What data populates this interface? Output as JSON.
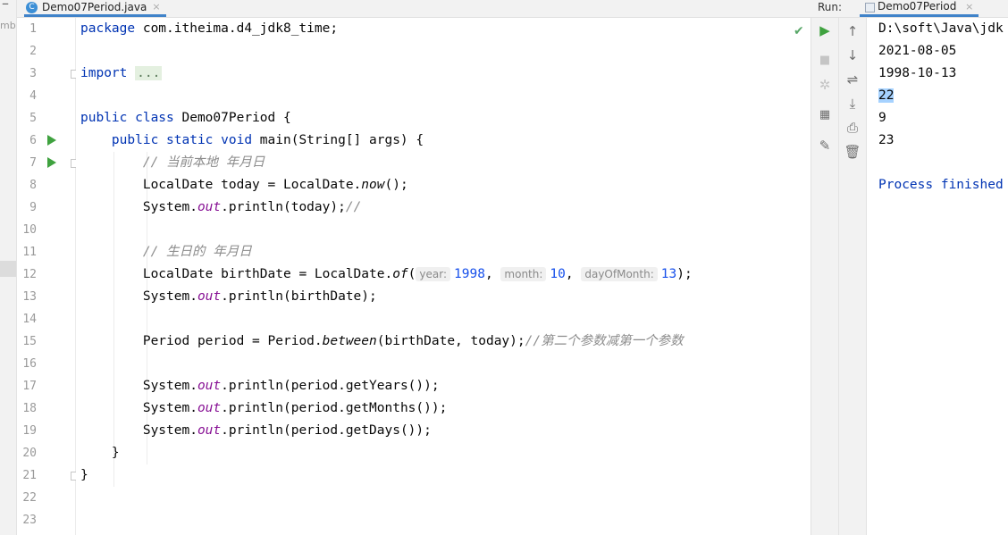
{
  "left_strip": {
    "text": "mb"
  },
  "editor": {
    "tab_title": "Demo07Period.java",
    "tab_close": "×",
    "class_icon_letter": "C",
    "line_numbers": [
      "1",
      "2",
      "3",
      "4",
      "5",
      "6",
      "7",
      "8",
      "9",
      "10",
      "11",
      "12",
      "13",
      "14",
      "15",
      "16",
      "17",
      "18",
      "19",
      "20",
      "21",
      "22",
      "23"
    ],
    "code": {
      "l1_kw": "package",
      "l1_rest": " com.itheima.d4_jdk8_time;",
      "l3_kw": "import",
      "l3_fold": "...",
      "l6_kw": "public class",
      "l6_rest": " Demo07Period {",
      "l7_kw": "public static void",
      "l7_rest": " main(String[] args) {",
      "l8_comment": "// 当前本地 年月日",
      "l9_a": "LocalDate today = LocalDate.",
      "l9_method": "now",
      "l9_b": "();",
      "l10_a": "System.",
      "l10_field": "out",
      "l10_b": ".println(today);",
      "l10_comment": "//",
      "l12_comment": "// 生日的 年月日",
      "l13_a": "LocalDate birthDate = LocalDate.",
      "l13_method": "of",
      "l13_b": "(",
      "l13_hint_year": "year:",
      "l13_year": "1998",
      "l13_sep1": ", ",
      "l13_hint_month": "month:",
      "l13_month": "10",
      "l13_sep2": ", ",
      "l13_hint_day": "dayOfMonth:",
      "l13_day": "13",
      "l13_c": ");",
      "l14_a": "System.",
      "l14_field": "out",
      "l14_b": ".println(birthDate);",
      "l16_a": "Period period = Period.",
      "l16_method": "between",
      "l16_b": "(birthDate, today);",
      "l16_comment": "//第二个参数减第一个参数",
      "l18_a": "System.",
      "l18_field": "out",
      "l18_b": ".println(period.getYears());",
      "l19_a": "System.",
      "l19_field": "out",
      "l19_b": ".println(period.getMonths());",
      "l20_a": "System.",
      "l20_field": "out",
      "l20_b": ".println(period.getDays());",
      "l21": "}",
      "l22": "}"
    },
    "check_icon": "✔"
  },
  "run_window": {
    "label": "Run:",
    "tab_title": "Demo07Period",
    "tab_close": "×",
    "console_lines": {
      "path": "D:\\soft\\Java\\jdk",
      "date_today": "2021-08-05",
      "date_birth": "1998-10-13",
      "years": "22",
      "months": "9",
      "days": "23",
      "process": "Process finished"
    }
  },
  "colors": {
    "keyword": "#0033b3",
    "field": "#871094",
    "number": "#1750eb",
    "comment": "#8c8c8c",
    "run_arrow": "#3fa23f",
    "selection": "#a6d2ff",
    "current_line": "#fcfaed"
  },
  "icons": [
    "class-icon",
    "run-gutter-icon",
    "fold-icon",
    "check-icon",
    "rerun-icon",
    "stop-icon",
    "debug-icon",
    "layout-icon",
    "pin-icon",
    "up-arrow-icon",
    "down-arrow-icon",
    "soft-wrap-icon",
    "scroll-to-end-icon",
    "print-icon",
    "trash-icon"
  ]
}
